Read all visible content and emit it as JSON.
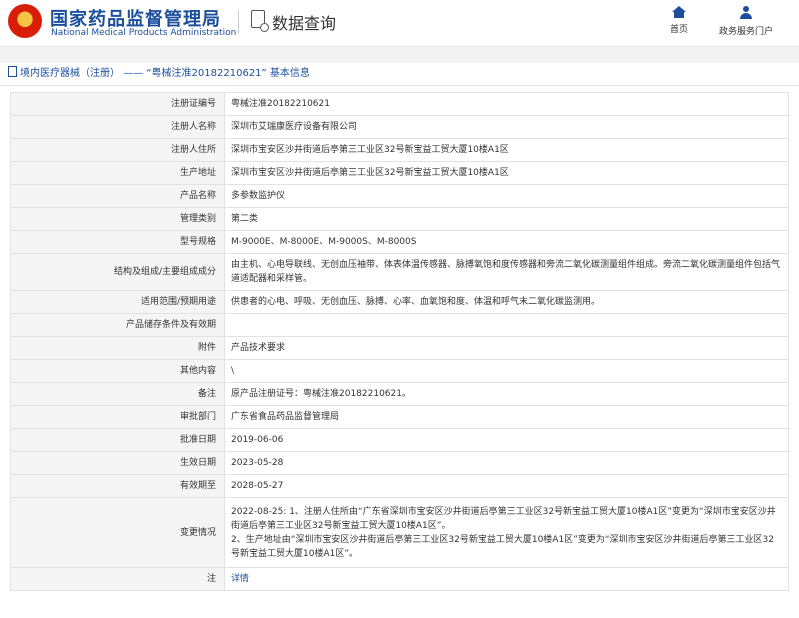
{
  "header": {
    "brand_cn": "国家药品监督管理局",
    "brand_en": "National Medical Products Administration",
    "section_title": "数据查询",
    "nav_home": "首页",
    "nav_portal": "政务服务门户"
  },
  "breadcrumb": {
    "category": "境内医疗器械（注册）",
    "separator": "——",
    "record": "“粤械注准20182210621”",
    "suffix": "基本信息"
  },
  "rows": [
    {
      "label": "注册证编号",
      "value": "粤械注准20182210621"
    },
    {
      "label": "注册人名称",
      "value": "深圳市艾瑞康医疗设备有限公司"
    },
    {
      "label": "注册人住所",
      "value": "深圳市宝安区沙井街道后亭第三工业区32号新宝益工贸大厦10楼A1区"
    },
    {
      "label": "生产地址",
      "value": "深圳市宝安区沙井街道后亭第三工业区32号新宝益工贸大厦10楼A1区"
    },
    {
      "label": "产品名称",
      "value": "多参数监护仪"
    },
    {
      "label": "管理类别",
      "value": "第二类"
    },
    {
      "label": "型号规格",
      "value": "M-9000E、M-8000E、M-9000S、M-8000S"
    },
    {
      "label": "结构及组成/主要组成成分",
      "value": "由主机、心电导联线、无创血压袖带、体表体温传感器、脉搏氧饱和度传感器和旁流二氧化碳测量组件组成。旁流二氧化碳测量组件包括气道适配器和采样管。"
    },
    {
      "label": "适用范围/预期用途",
      "value": "供患者的心电、呼吸、无创血压、脉搏、心率、血氧饱和度、体温和呼气末二氧化碳监测用。"
    },
    {
      "label": "产品储存条件及有效期",
      "value": ""
    },
    {
      "label": "附件",
      "value": "产品技术要求"
    },
    {
      "label": "其他内容",
      "value": "\\"
    },
    {
      "label": "备注",
      "value": "原产品注册证号：粤械注准20182210621。"
    },
    {
      "label": "审批部门",
      "value": "广东省食品药品监督管理局"
    },
    {
      "label": "批准日期",
      "value": "2019-06-06"
    },
    {
      "label": "生效日期",
      "value": "2023-05-28"
    },
    {
      "label": "有效期至",
      "value": "2028-05-27"
    },
    {
      "label": "变更情况",
      "value": "2022-08-25: 1、注册人住所由“广东省深圳市宝安区沙井街道后亭第三工业区32号新宝益工贸大厦10楼A1区”变更为“深圳市宝安区沙井街道后亭第三工业区32号新宝益工贸大厦10楼A1区”。\n2、生产地址由“深圳市宝安区沙井街道后亭第三工业区32号新宝益工贸大厦10楼A1区”变更为“深圳市宝安区沙井街道后亭第三工业区32号新宝益工贸大厦10楼A1区”。"
    },
    {
      "label": "注",
      "value": "详情"
    }
  ]
}
